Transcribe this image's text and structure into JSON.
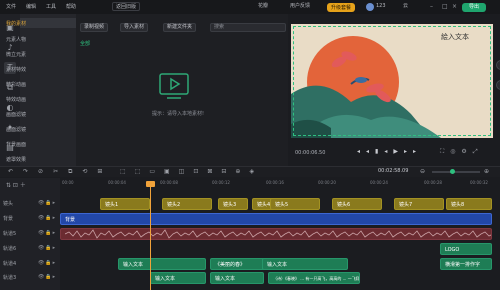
{
  "menu": [
    "文件",
    "编辑",
    "工具",
    "帮助"
  ],
  "old_version": "返回旧版",
  "top_right": {
    "record": "花瓣",
    "user_feedback": "用户反馈",
    "upgrade": "升级套餐",
    "account": "123",
    "cloud": "云",
    "export": "导出"
  },
  "rail": [
    "素材",
    "音乐",
    "文字",
    "转场",
    "滤镜",
    "特效",
    "素材库"
  ],
  "library": {
    "items": [
      "我的素材",
      "元素人物",
      "微立元素",
      "素材特效",
      "精彩动画",
      "特效动画",
      "画面滤镜",
      "画面滤镜",
      "背景画面",
      "遮罩效果"
    ]
  },
  "media": {
    "buttons": [
      "录制视频",
      "导入素材",
      "新建文件夹"
    ],
    "search_placeholder": "搜索",
    "filter": "全部",
    "empty_hint": "提示：请导入本地素材!"
  },
  "preview": {
    "timecode": "00:00:06.50",
    "title_text": "絵入文本"
  },
  "timeline": {
    "duration": "00:02:58.09",
    "ticks": [
      "00:00",
      "00:00:04",
      "00:00:08",
      "00:00:12",
      "00:00:16",
      "00:00:20",
      "00:00:24",
      "00:00:28",
      "00:00:32"
    ],
    "tracks": [
      "镜头",
      "背景",
      "轨道5",
      "轨道6",
      "轨道4",
      "轨道3",
      "轨道2"
    ],
    "lens_clips": [
      "镜头1",
      "镜头2",
      "镜头3",
      "镜头4",
      "镜头5",
      "镜头6",
      "镜头7",
      "镜头8"
    ],
    "bg_clip": "背景",
    "text_clips": [
      "输入文本",
      "《美丽的春》",
      "输入文本",
      "输入文本",
      "输入文本",
      "LOGO",
      "横滑第一排作字"
    ],
    "bottom_text": "（诗）《春晓》 ... 有一只高飞，高高的 ... 一飞翔，飞出了 ... 轻轻一夏 ... 春眠不觉晓 ... 高耸一个中一！"
  },
  "colors": {
    "accent_green": "#1fa56e",
    "upgrade": "#e6a21a",
    "playhead": "#f0a23a",
    "lens": "#8a7a1d",
    "bg": "#2247a8",
    "audio": "#6b2b31",
    "text": "#1e7d55"
  }
}
